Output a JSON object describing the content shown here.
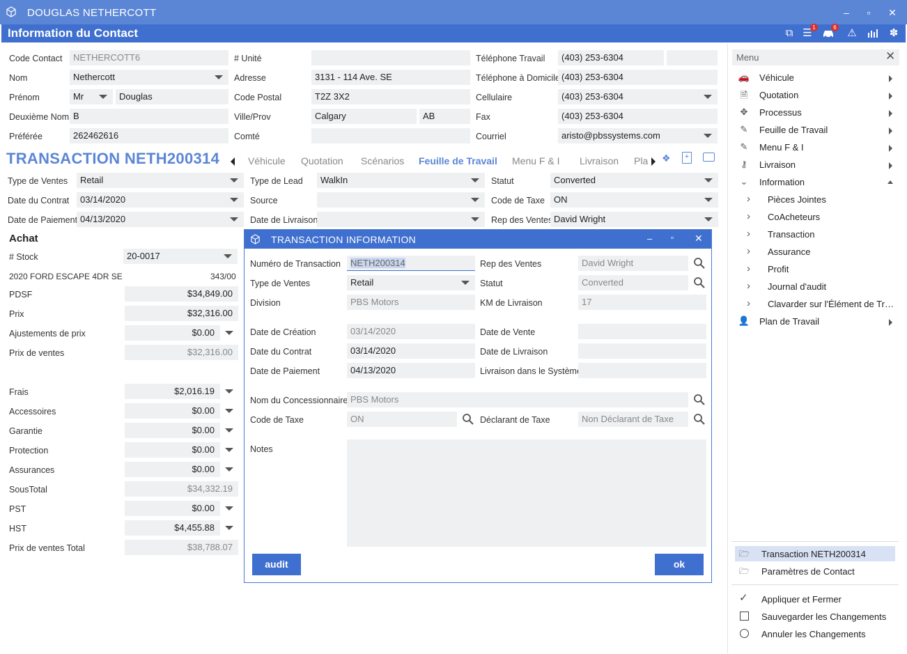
{
  "window": {
    "title": "DOUGLAS NETHERCOTT",
    "minimize": "‒",
    "maximize": "▫",
    "close": "✕"
  },
  "header": {
    "title": "Information du Contact",
    "badge1": "1",
    "badge2": "6"
  },
  "contact": {
    "code_label": "Code Contact",
    "code_value": "NETHERCOTT6",
    "nom_label": "Nom",
    "nom_value": "Nethercott",
    "prenom_label": "Prénom",
    "prenom_title": "Mr",
    "prenom_value": "Douglas",
    "deuxieme_label": "Deuxième Nom",
    "deuxieme_value": "B",
    "preferee_label": "Préférée",
    "preferee_value": "262462616",
    "unite_label": "# Unité",
    "unite_value": "",
    "adresse_label": "Adresse",
    "adresse_value": "3131 - 114 Ave. SE",
    "postal_label": "Code Postal",
    "postal_value": "T2Z 3X2",
    "ville_label": "Ville/Prov",
    "ville_value": "Calgary",
    "prov_value": "AB",
    "comte_label": "Comté",
    "comte_value": "",
    "tel_travail_label": "Téléphone Travail",
    "tel_travail_value": "(403) 253-6304",
    "tel_domicile_label": "Téléphone à Domicile",
    "tel_domicile_value": "(403) 253-6304",
    "cellulaire_label": "Cellulaire",
    "cellulaire_value": "(403) 253-6304",
    "fax_label": "Fax",
    "fax_value": "(403) 253-6304",
    "courriel_label": "Courriel",
    "courriel_value": "aristo@pbssystems.com"
  },
  "transaction": {
    "title": "TRANSACTION NETH200314",
    "tabs": [
      "Véhicule",
      "Quotation",
      "Scénarios",
      "Feuille de Travail",
      "Menu F & I",
      "Livraison",
      "Pla"
    ],
    "type_ventes_label": "Type de Ventes",
    "type_ventes_value": "Retail",
    "date_contrat_label": "Date du Contrat",
    "date_contrat_value": "03/14/2020",
    "date_paiement_label": "Date de Paiement",
    "date_paiement_value": "04/13/2020",
    "type_lead_label": "Type de Lead",
    "type_lead_value": "WalkIn",
    "source_label": "Source",
    "source_value": "",
    "date_livraison_label": "Date de Livraison",
    "date_livraison_value": "",
    "statut_label": "Statut",
    "statut_value": "Converted",
    "code_taxe_label": "Code de Taxe",
    "code_taxe_value": "ON",
    "rep_label": "Rep des Ventes",
    "rep_value": "David Wright"
  },
  "achat": {
    "title": "Achat",
    "stock_label": "# Stock",
    "stock_value": "20-0017",
    "vehicle": "2020 FORD ESCAPE 4DR SE",
    "vehicle_code": "343/00",
    "rows": [
      {
        "label": "PDSF",
        "value": "$34,849.00",
        "ro": false,
        "dd": false
      },
      {
        "label": "Prix",
        "value": "$32,316.00",
        "ro": false,
        "dd": false
      },
      {
        "label": "Ajustements de prix",
        "value": "$0.00",
        "ro": false,
        "dd": true
      },
      {
        "label": "Prix de ventes",
        "value": "$32,316.00",
        "ro": true,
        "dd": false
      }
    ],
    "rows2": [
      {
        "label": "Frais",
        "value": "$2,016.19",
        "ro": false,
        "dd": true
      },
      {
        "label": "Accessoires",
        "value": "$0.00",
        "ro": false,
        "dd": true
      },
      {
        "label": "Garantie",
        "value": "$0.00",
        "ro": false,
        "dd": true
      },
      {
        "label": "Protection",
        "value": "$0.00",
        "ro": false,
        "dd": true
      },
      {
        "label": "Assurances",
        "value": "$0.00",
        "ro": false,
        "dd": true
      },
      {
        "label": "SousTotal",
        "value": "$34,332.19",
        "ro": true,
        "dd": false
      },
      {
        "label": "PST",
        "value": "$0.00",
        "ro": false,
        "dd": true
      },
      {
        "label": "HST",
        "value": "$4,455.88",
        "ro": false,
        "dd": true
      },
      {
        "label": "Prix de ventes Total",
        "value": "$38,788.07",
        "ro": true,
        "dd": false
      }
    ]
  },
  "dialog": {
    "title": "TRANSACTION INFORMATION",
    "numero_label": "Numéro de Transaction",
    "numero_value": "NETH200314",
    "type_label": "Type de Ventes",
    "type_value": "Retail",
    "division_label": "Division",
    "division_value": "PBS Motors",
    "rep_label": "Rep des Ventes",
    "rep_value": "David Wright",
    "statut_label": "Statut",
    "statut_value": "Converted",
    "km_label": "KM de Livraison",
    "km_value": "17",
    "creation_label": "Date de Création",
    "creation_value": "03/14/2020",
    "contrat_label": "Date du Contrat",
    "contrat_value": "03/14/2020",
    "paiement_label": "Date de Paiement",
    "paiement_value": "04/13/2020",
    "vente_label": "Date de Vente",
    "vente_value": "",
    "livraison_label": "Date de Livraison",
    "livraison_value": "",
    "systeme_label": "Livraison dans le Système",
    "systeme_value": "",
    "concess_label": "Nom du Concessionnaire",
    "concess_value": "PBS Motors",
    "taxe_label": "Code de Taxe",
    "taxe_value": "ON",
    "declarant_label": "Déclarant de Taxe",
    "declarant_value": "Non Déclarant de Taxe",
    "notes_label": "Notes",
    "audit_button": "audit",
    "ok_button": "ok"
  },
  "menu": {
    "title": "Menu",
    "items": [
      {
        "label": "Véhicule",
        "icon": "car-icon"
      },
      {
        "label": "Quotation",
        "icon": "document-icon"
      },
      {
        "label": "Processus",
        "icon": "process-icon"
      },
      {
        "label": "Feuille de Travail",
        "icon": "pencil-icon"
      },
      {
        "label": "Menu F & I",
        "icon": "pencil-icon"
      },
      {
        "label": "Livraison",
        "icon": "key-icon"
      },
      {
        "label": "Information",
        "icon": "chevron-down-icon"
      }
    ],
    "sub_items": [
      "Pièces Jointes",
      "CoAcheteurs",
      "Transaction",
      "Assurance",
      "Profit",
      "Journal d'audit",
      "Clavarder sur l'Élément de Transaction"
    ],
    "plan": "Plan de Travail",
    "bottom_items": [
      "Transaction NETH200314",
      "Paramètres de Contact"
    ],
    "actions": [
      "Appliquer et Fermer",
      "Sauvegarder les Changements",
      "Annuler les Changements"
    ]
  }
}
